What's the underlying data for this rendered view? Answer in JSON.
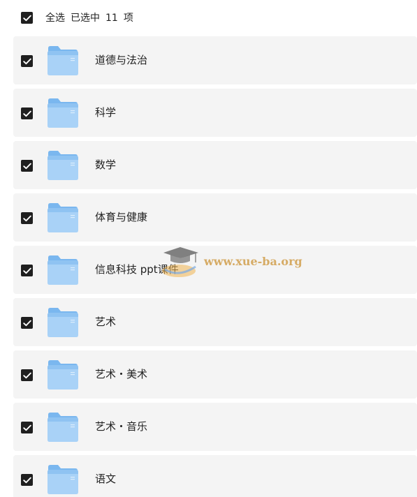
{
  "header": {
    "select_all_label": "全选",
    "selected_prefix": "已选中",
    "selected_count": "11",
    "selected_suffix": "项"
  },
  "items": [
    {
      "label": "道德与法治",
      "icon": "folder-icon",
      "checked": true
    },
    {
      "label": "科学",
      "icon": "folder-icon",
      "checked": true
    },
    {
      "label": "数学",
      "icon": "folder-icon",
      "checked": true
    },
    {
      "label": "体育与健康",
      "icon": "folder-icon",
      "checked": true
    },
    {
      "label": "信息科技 ppt课件",
      "icon": "folder-icon",
      "checked": true
    },
    {
      "label": "艺术",
      "icon": "folder-icon",
      "checked": true
    },
    {
      "label": "艺术・美术",
      "icon": "folder-icon",
      "checked": true
    },
    {
      "label": "艺术・音乐",
      "icon": "folder-icon",
      "checked": true
    },
    {
      "label": "语文",
      "icon": "folder-icon",
      "checked": true
    }
  ],
  "watermark": {
    "text": "www.xue-ba.org",
    "icon": "graduation-cap-icon"
  },
  "colors": {
    "checkbox": "#1f1f1f",
    "row_background": "#f4f4f4",
    "folder_light": "#a9d2f7",
    "folder_dark": "#7ab7ef",
    "watermark": "#cd963c"
  }
}
